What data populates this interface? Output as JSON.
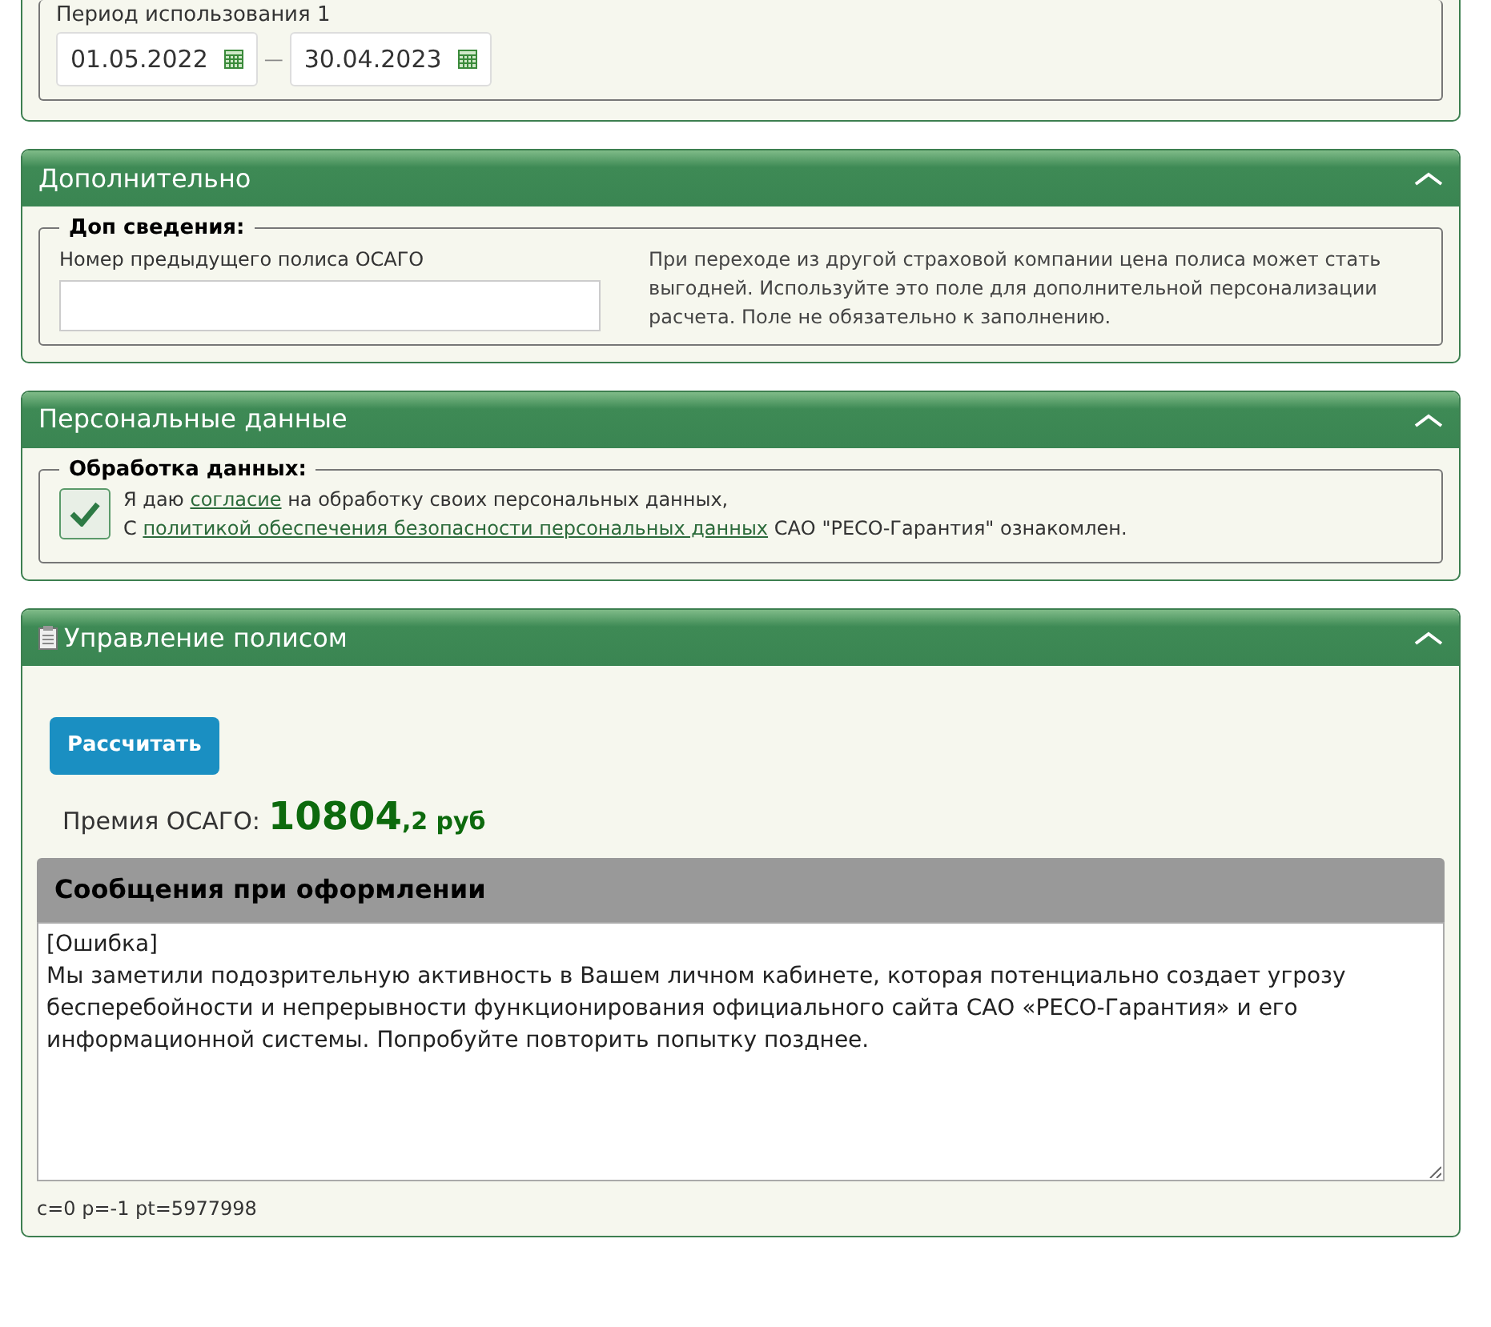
{
  "period": {
    "label": "Период использования 1",
    "date_from": "01.05.2022",
    "separator": "—",
    "date_to": "30.04.2023"
  },
  "panels": [
    {
      "kind": "extra",
      "title": "Дополнительно",
      "legend": "Доп сведения:",
      "field_label": "Номер предыдущего полиса ОСАГО",
      "hint": "При переходе из другой страховой компании цена полиса может стать выгодней. Используйте это поле для дополнительной персонализации расчета. Поле не обязательно к заполнению."
    },
    {
      "kind": "consent",
      "title": "Персональные данные",
      "legend": "Обработка данных:",
      "checked": true,
      "segments": [
        {
          "kind": "text",
          "text": "Я даю "
        },
        {
          "kind": "link",
          "text": "согласие"
        },
        {
          "kind": "text",
          "text": " на обработку своих персональных данных,"
        },
        {
          "kind": "break"
        },
        {
          "kind": "text",
          "text": "С "
        },
        {
          "kind": "link",
          "text": "политикой обеспечения безопасности персональных данных"
        },
        {
          "kind": "text",
          "text": " САО \"РЕСО-Гарантия\" ознакомлен."
        }
      ]
    },
    {
      "kind": "policy",
      "title": "Управление полисом",
      "button": "Рассчитать",
      "premium_label": "Премия ОСАГО:",
      "premium_main": "10804",
      "premium_fraction": ",2 руб",
      "messages_title": "Сообщения при оформлении",
      "messages": [
        "[Ошибка]",
        "Мы заметили подозрительную активность в Вашем личном кабинете, которая потенциально создает угрозу бесперебойности и непрерывности функционирования официального сайта САО «РЕСО-Гарантия» и его информационной системы. Попробуйте повторить попытку позднее."
      ],
      "debug": "c=0 p=-1 pt=5977998"
    }
  ]
}
